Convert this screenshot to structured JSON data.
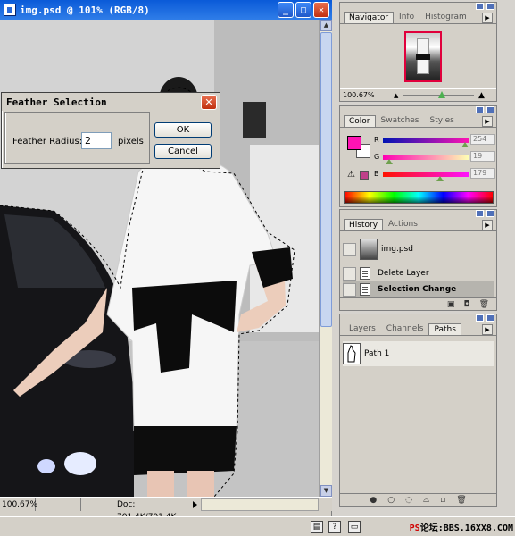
{
  "document": {
    "title": "img.psd @ 101% (RGB/8)",
    "zoom": "100.67%",
    "doc_size": "Doc: 701.4K/701.4K",
    "buttons": {
      "minimize": "_",
      "maximize": "□",
      "close": "✕"
    }
  },
  "dialog": {
    "title": "Feather Selection",
    "radius_label": "Feather Radius:",
    "radius_value": "2",
    "unit": "pixels",
    "ok": "OK",
    "cancel": "Cancel",
    "close": "✕"
  },
  "navigator": {
    "tabs": [
      "Navigator",
      "Info",
      "Histogram"
    ],
    "zoom": "100.67%"
  },
  "color": {
    "tabs": [
      "Color",
      "Swatches",
      "Styles"
    ],
    "channels": [
      {
        "label": "R",
        "value": "254"
      },
      {
        "label": "G",
        "value": "19"
      },
      {
        "label": "B",
        "value": "179"
      }
    ],
    "foreground": "#fe13b3",
    "background": "#ffffff",
    "gamut_swatch": "#c0408a"
  },
  "history": {
    "tabs": [
      "History",
      "Actions"
    ],
    "snapshot": "img.psd",
    "items": [
      "Delete Layer",
      "Selection Change"
    ]
  },
  "layers": {
    "tabs": [
      "Layers",
      "Channels",
      "Paths"
    ],
    "paths": [
      "Path 1"
    ]
  },
  "taskbar": {
    "watermark": "PS论坛:BBS.16XX8.COM"
  }
}
